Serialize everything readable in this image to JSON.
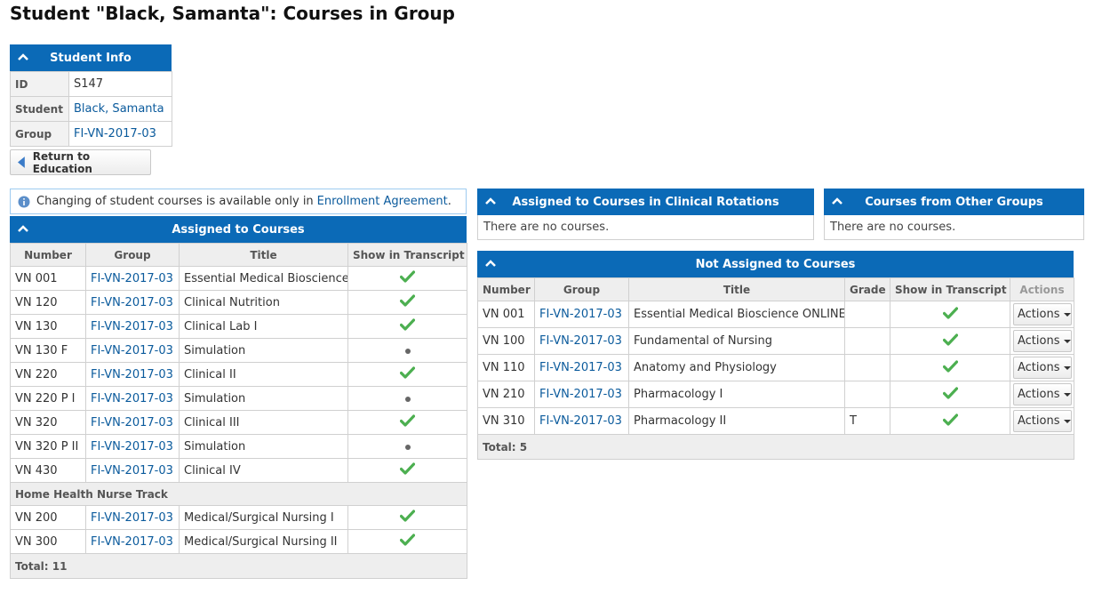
{
  "page_title": "Student \"Black, Samanta\": Courses in Group",
  "student_info": {
    "header": "Student Info",
    "rows": [
      {
        "label": "ID",
        "value": "S147",
        "link": false
      },
      {
        "label": "Student",
        "value": "Black, Samanta",
        "link": true
      },
      {
        "label": "Group",
        "value": "FI-VN-2017-03",
        "link": true
      }
    ]
  },
  "return_button": "Return to Education",
  "notice": {
    "text": "Changing of student courses is available only in ",
    "link": "Enrollment Agreement",
    "suffix": "."
  },
  "assigned": {
    "header": "Assigned to Courses",
    "columns": [
      "Number",
      "Group",
      "Title",
      "Show in Transcript"
    ],
    "rows": [
      {
        "number": "VN 001",
        "group": "FI-VN-2017-03",
        "title": "Essential Medical Bioscience",
        "transcript": "check"
      },
      {
        "number": "VN 120",
        "group": "FI-VN-2017-03",
        "title": "Clinical Nutrition",
        "transcript": "check"
      },
      {
        "number": "VN 130",
        "group": "FI-VN-2017-03",
        "title": "Clinical Lab I",
        "transcript": "check"
      },
      {
        "number": "VN 130 F",
        "group": "FI-VN-2017-03",
        "title": "Simulation",
        "transcript": "dot"
      },
      {
        "number": "VN 220",
        "group": "FI-VN-2017-03",
        "title": "Clinical II",
        "transcript": "check"
      },
      {
        "number": "VN 220 P I",
        "group": "FI-VN-2017-03",
        "title": "Simulation",
        "transcript": "dot"
      },
      {
        "number": "VN 320",
        "group": "FI-VN-2017-03",
        "title": "Clinical III",
        "transcript": "check"
      },
      {
        "number": "VN 320 P II",
        "group": "FI-VN-2017-03",
        "title": "Simulation",
        "transcript": "dot"
      },
      {
        "number": "VN 430",
        "group": "FI-VN-2017-03",
        "title": "Clinical IV",
        "transcript": "check"
      }
    ],
    "track_label": "Home Health Nurse Track",
    "track_rows": [
      {
        "number": "VN 200",
        "group": "FI-VN-2017-03",
        "title": "Medical/Surgical Nursing I",
        "transcript": "check"
      },
      {
        "number": "VN 300",
        "group": "FI-VN-2017-03",
        "title": "Medical/Surgical Nursing II",
        "transcript": "check"
      }
    ],
    "total": "Total: 11"
  },
  "clinical": {
    "header": "Assigned to Courses in Clinical Rotations",
    "empty_text": "There are no courses."
  },
  "other_groups": {
    "header": "Courses from Other Groups",
    "empty_text": "There are no courses."
  },
  "not_assigned": {
    "header": "Not Assigned to Courses",
    "columns": [
      "Number",
      "Group",
      "Title",
      "Grade",
      "Show in Transcript",
      "Actions"
    ],
    "rows": [
      {
        "number": "VN 001",
        "group": "FI-VN-2017-03",
        "title": "Essential Medical Bioscience ONLINE",
        "grade": "",
        "transcript": "check",
        "action": "Actions"
      },
      {
        "number": "VN 100",
        "group": "FI-VN-2017-03",
        "title": "Fundamental of Nursing",
        "grade": "",
        "transcript": "check",
        "action": "Actions"
      },
      {
        "number": "VN 110",
        "group": "FI-VN-2017-03",
        "title": "Anatomy and Physiology",
        "grade": "",
        "transcript": "check",
        "action": "Actions"
      },
      {
        "number": "VN 210",
        "group": "FI-VN-2017-03",
        "title": "Pharmacology I",
        "grade": "",
        "transcript": "check",
        "action": "Actions"
      },
      {
        "number": "VN 310",
        "group": "FI-VN-2017-03",
        "title": "Pharmacology II",
        "grade": "T",
        "transcript": "check",
        "action": "Actions"
      }
    ],
    "total": "Total: 5"
  },
  "colors": {
    "header_blue": "#0b6ab7",
    "link_blue": "#0a5a9c",
    "check_green": "#4caf50"
  }
}
